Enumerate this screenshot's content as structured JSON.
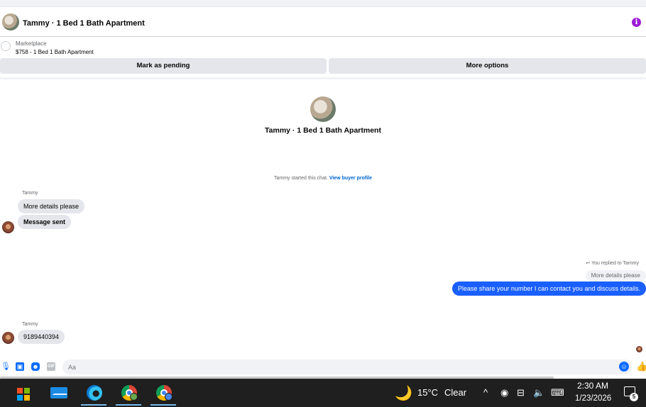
{
  "header": {
    "title": "Tammy · 1 Bed 1 Bath Apartment",
    "info_icon": "info-icon"
  },
  "listing": {
    "label": "Marketplace",
    "summary": "$758 - 1 Bed 1 Bath Apartment"
  },
  "actions": {
    "mark_pending": "Mark as pending",
    "more_options": "More options"
  },
  "intro": {
    "title": "Tammy · 1 Bed 1 Bath Apartment",
    "started_text": "Tammy started this chat.",
    "view_profile": "View buyer profile"
  },
  "messages": {
    "group1_sender": "Tammy",
    "m1": "More details please",
    "m2": "Message sent",
    "replied_to": "You replied to Tammy",
    "reply_quote": "More details please",
    "m3": "Please share your number I can contact you and discuss details.",
    "group2_sender": "Tammy",
    "m4": "9189440394"
  },
  "composer": {
    "placeholder": "Aa"
  },
  "taskbar": {
    "weather_temp": "15°C",
    "weather_cond": "Clear",
    "time": "2:30 AM",
    "date": "1/23/2026",
    "notif_count": "5"
  },
  "colors": {
    "accent": "#0a6cff",
    "outgoing_bubble": "#1a5fff",
    "info": "#9d1bd6",
    "taskbar": "#1f1f1f"
  }
}
